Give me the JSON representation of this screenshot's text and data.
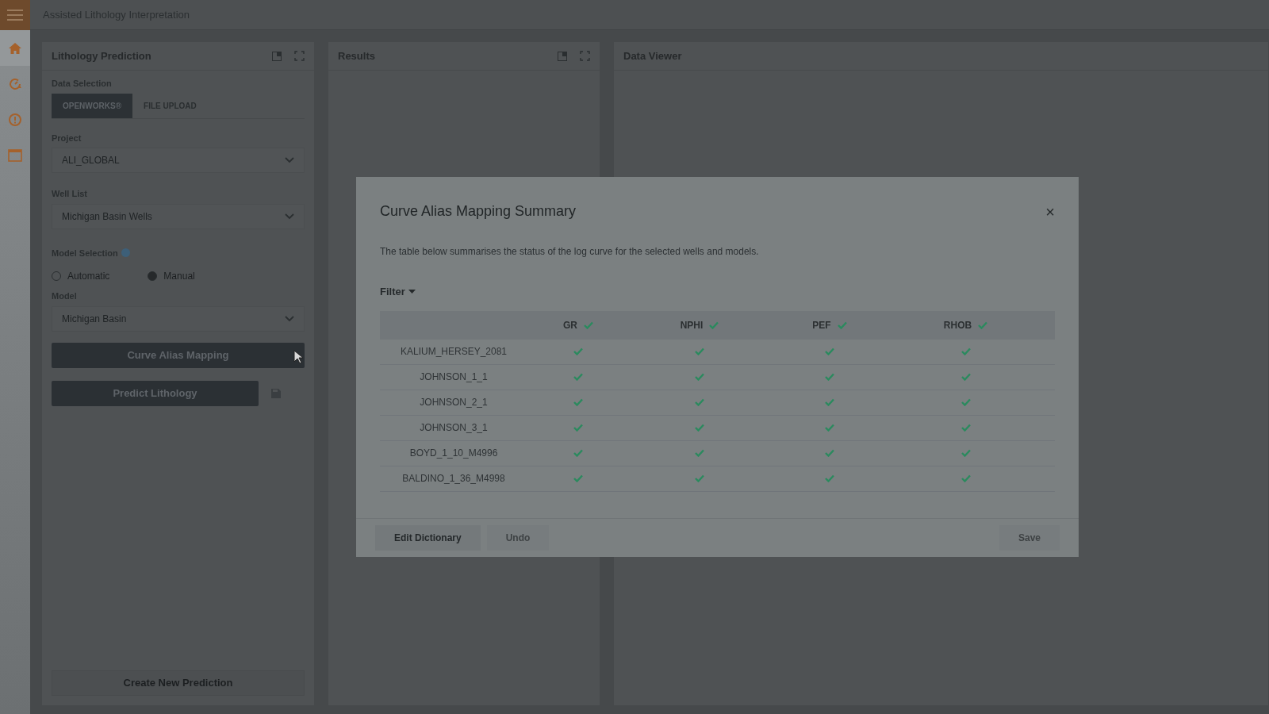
{
  "app": {
    "title": "Assisted Lithology Interpretation"
  },
  "sidebar": {
    "items": [
      {
        "kind": "home",
        "selected": true
      },
      {
        "kind": "gauge",
        "selected": false
      },
      {
        "kind": "info",
        "selected": false
      },
      {
        "kind": "window",
        "selected": false
      }
    ]
  },
  "lithology_panel": {
    "title": "Lithology Prediction",
    "data_selection_label": "Data Selection",
    "tabs": [
      {
        "label": "OPENWORKS®",
        "selected": true
      },
      {
        "label": "FILE UPLOAD",
        "selected": false
      }
    ],
    "fields": [
      {
        "label": "Project",
        "value": "ALI_GLOBAL"
      },
      {
        "label": "Well List",
        "value": "Michigan Basin Wells"
      }
    ],
    "model_selection_label": "Model Selection",
    "radios": [
      {
        "label": "Automatic",
        "selected": false
      },
      {
        "label": "Manual",
        "selected": true
      }
    ],
    "model": {
      "label": "Model",
      "value": "Michigan Basin"
    },
    "curve_alias_button": "Curve Alias Mapping",
    "predict_button": "Predict Lithology",
    "create_button": "Create New Prediction"
  },
  "results_panel": {
    "title": "Results"
  },
  "data_viewer_panel": {
    "title": "Data Viewer"
  },
  "modal": {
    "title": "Curve Alias Mapping Summary",
    "close": "×",
    "description": "The table below summarises the status of the log curve for the selected wells and models.",
    "filter": "Filter",
    "columns": [
      {
        "label": "GR",
        "mapped": true
      },
      {
        "label": "NPHI",
        "mapped": true
      },
      {
        "label": "PEF",
        "mapped": true
      },
      {
        "label": "RHOB",
        "mapped": true
      }
    ],
    "rows": [
      {
        "well": "KALIUM_HERSEY_2081",
        "mapped": [
          true,
          true,
          true,
          true
        ]
      },
      {
        "well": "JOHNSON_1_1",
        "mapped": [
          true,
          true,
          true,
          true
        ]
      },
      {
        "well": "JOHNSON_2_1",
        "mapped": [
          true,
          true,
          true,
          true
        ]
      },
      {
        "well": "JOHNSON_3_1",
        "mapped": [
          true,
          true,
          true,
          true
        ]
      },
      {
        "well": "BOYD_1_10_M4996",
        "mapped": [
          true,
          true,
          true,
          true
        ]
      },
      {
        "well": "BALDINO_1_36_M4998",
        "mapped": [
          true,
          true,
          true,
          true
        ]
      }
    ],
    "buttons": [
      {
        "label": "Edit Dictionary",
        "disabled": false
      },
      {
        "label": "Undo",
        "disabled": true
      },
      {
        "label": "Save",
        "disabled": true
      }
    ]
  }
}
